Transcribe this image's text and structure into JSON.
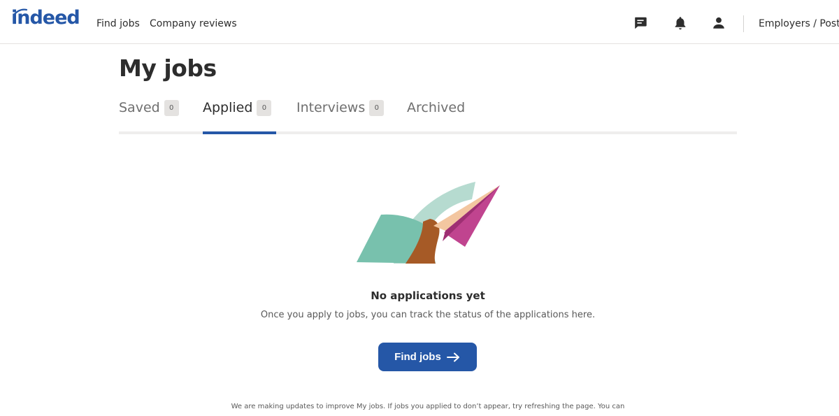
{
  "header": {
    "logo_text": "indeed",
    "nav": [
      {
        "label": "Find jobs"
      },
      {
        "label": "Company reviews"
      }
    ],
    "icons": [
      "messages-icon",
      "notifications-icon",
      "profile-icon"
    ],
    "employers_label": "Employers / Post Jo"
  },
  "main": {
    "title": "My jobs",
    "tabs": [
      {
        "label": "Saved",
        "count": "0",
        "active": false
      },
      {
        "label": "Applied",
        "count": "0",
        "active": true
      },
      {
        "label": "Interviews",
        "count": "0",
        "active": false
      },
      {
        "label": "Archived",
        "active": false
      }
    ],
    "empty_state": {
      "title": "No applications yet",
      "description": "Once you apply to jobs, you can track the status of the applications here.",
      "button_label": "Find jobs"
    },
    "footnote": "We are making updates to improve My jobs. If jobs you applied to don’t appear, try refreshing the page. You can"
  },
  "colors": {
    "brand_blue": "#2557a7",
    "tab_count_bg": "#e4e2e0",
    "illustration_teal": "#78c1ad",
    "illustration_light_teal": "#b6dbd0",
    "illustration_magenta": "#c0448f",
    "illustration_peach": "#f3c6a0",
    "illustration_skin": "#a65a26"
  }
}
